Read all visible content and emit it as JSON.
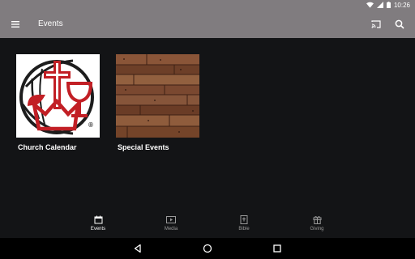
{
  "status_bar": {
    "time": "10:26",
    "icons": [
      "wifi-icon",
      "cell-signal-icon",
      "battery-icon"
    ]
  },
  "app_bar": {
    "title": "Events",
    "icons": [
      "menu-icon",
      "cast-icon",
      "search-icon"
    ]
  },
  "cards": [
    {
      "label": "Church Calendar",
      "image": "church-logo"
    },
    {
      "label": "Special Events",
      "image": "wood-texture"
    }
  ],
  "bottom_nav": {
    "items": [
      {
        "label": "Events",
        "icon": "calendar-icon",
        "active": true
      },
      {
        "label": "Media",
        "icon": "media-icon",
        "active": false
      },
      {
        "label": "Bible",
        "icon": "bible-icon",
        "active": false
      },
      {
        "label": "Giving",
        "icon": "gift-icon",
        "active": false
      }
    ]
  },
  "system_nav": {
    "buttons": [
      "back-icon",
      "home-icon",
      "recents-icon"
    ]
  },
  "colors": {
    "app_bar": "#807c7f",
    "background": "#131416",
    "accent_red": "#c21f25",
    "nav_inactive": "#9a9a9a"
  },
  "logo_mark": "®"
}
